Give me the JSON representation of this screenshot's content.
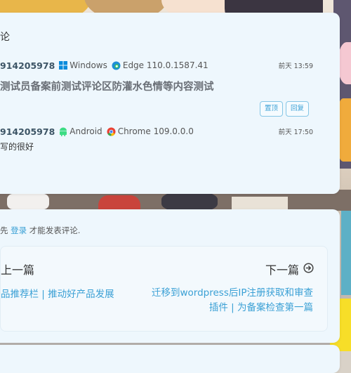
{
  "comments": {
    "title": "论",
    "items": [
      {
        "author": "914205978",
        "os": "Windows",
        "browser": "Edge 110.0.1587.41",
        "time": "前天 13:59",
        "text": "测试员备案前测试评论区防灌水色情等内容测试",
        "actions": {
          "top": "置顶",
          "reply": "回复"
        }
      },
      {
        "author": "914205978",
        "os": "Android",
        "browser": "Chrome 109.0.0.0",
        "time": "前天 17:50",
        "text": "写的很好"
      }
    ]
  },
  "comment_form": {
    "login_prefix": "先 ",
    "login_link": "登录",
    "login_suffix": " 才能发表评论."
  },
  "post_nav": {
    "prev_label": "上一篇",
    "prev_title": "品推荐栏 | 推动好产品发展",
    "next_label": "下一篇",
    "next_title": "迁移到wordpress后IP注册获取和审查插件 | 为备案检查第一篇"
  },
  "icons": {
    "windows": "windows-icon",
    "edge": "edge-icon",
    "android": "android-icon",
    "chrome": "chrome-icon",
    "next": "arrow-right-circle-icon"
  },
  "colors": {
    "accent": "#3aa0d5",
    "card": "#eef7fd"
  }
}
